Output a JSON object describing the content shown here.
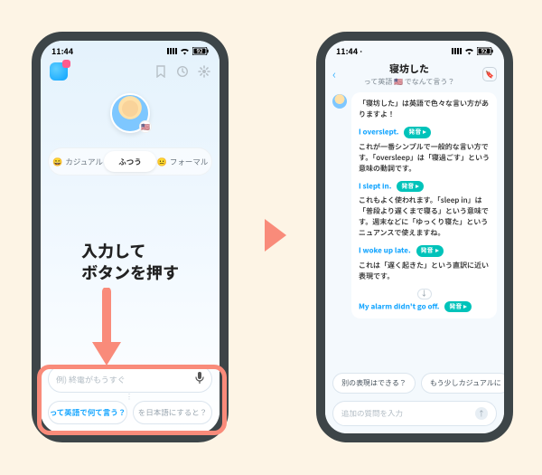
{
  "status": {
    "time": "11:44",
    "battery": "92"
  },
  "left": {
    "segments": {
      "casual": {
        "emoji": "😄",
        "label": "カジュアル"
      },
      "normal": {
        "label": "ふつう"
      },
      "formal": {
        "emoji": "😐",
        "label": "フォーマル"
      }
    },
    "input_placeholder": "例) 終電がもうすぐ",
    "buttons": {
      "to_english": "って英語で何て言う？",
      "to_japanese": "を日本語にすると？"
    }
  },
  "instruction": {
    "line1": "入力して",
    "line2": "ボタンを押す"
  },
  "right": {
    "title": "寝坊した",
    "subtitle": "って英語 🇺🇸 でなんて言う？",
    "intro": "「寝坊した」は英語で色々な言い方がありますよ！",
    "tag_label": "発音",
    "items": [
      {
        "phrase": "I overslept.",
        "desc": "これが一番シンプルで一般的な言い方です。「oversleep」は「寝過ごす」という意味の動詞です。"
      },
      {
        "phrase": "I slept in.",
        "desc": "これもよく使われます。「sleep in」は「普段より遅くまで寝る」という意味です。週末などに「ゆっくり寝た」というニュアンスで使えますね。"
      },
      {
        "phrase": "I woke up late.",
        "desc": "これは「遅く起きた」という直訳に近い表現です。"
      },
      {
        "phrase": "My alarm didn't go off.",
        "desc": ""
      }
    ],
    "suggestions": {
      "a": "別の表現はできる？",
      "b": "もう少しカジュアルに"
    },
    "input_placeholder": "追加の質問を入力"
  }
}
